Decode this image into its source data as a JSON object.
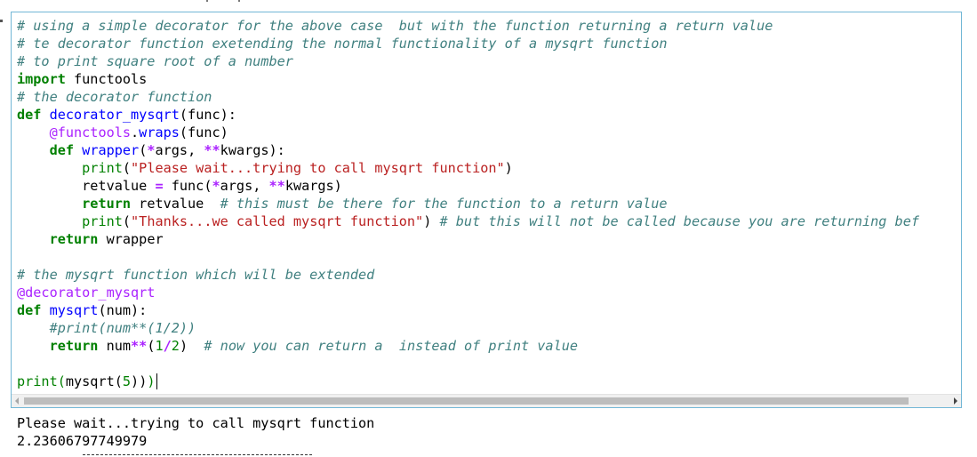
{
  "code_cell": {
    "lines": [
      [
        {
          "t": "c",
          "v": "# using a simple decorator for the above case  but with the function returning a return value"
        }
      ],
      [
        {
          "t": "c",
          "v": "# te decorator function exetending the normal functionality of a mysqrt function"
        }
      ],
      [
        {
          "t": "c",
          "v": "# to print square root of a number"
        }
      ],
      [
        {
          "t": "k",
          "v": "import"
        },
        {
          "t": "p",
          "v": " functools"
        }
      ],
      [
        {
          "t": "c",
          "v": "# the decorator function"
        }
      ],
      [
        {
          "t": "k",
          "v": "def"
        },
        {
          "t": "p",
          "v": " "
        },
        {
          "t": "fn",
          "v": "decorator_mysqrt"
        },
        {
          "t": "p",
          "v": "(func):"
        }
      ],
      [
        {
          "t": "p",
          "v": "    "
        },
        {
          "t": "d",
          "v": "@functools"
        },
        {
          "t": "p",
          "v": "."
        },
        {
          "t": "fn",
          "v": "wraps"
        },
        {
          "t": "p",
          "v": "(func)"
        }
      ],
      [
        {
          "t": "p",
          "v": "    "
        },
        {
          "t": "k",
          "v": "def"
        },
        {
          "t": "p",
          "v": " "
        },
        {
          "t": "fn",
          "v": "wrapper"
        },
        {
          "t": "p",
          "v": "("
        },
        {
          "t": "o",
          "v": "*"
        },
        {
          "t": "p",
          "v": "args, "
        },
        {
          "t": "o",
          "v": "**"
        },
        {
          "t": "p",
          "v": "kwargs):"
        }
      ],
      [
        {
          "t": "p",
          "v": "        "
        },
        {
          "t": "b",
          "v": "print"
        },
        {
          "t": "p",
          "v": "("
        },
        {
          "t": "s",
          "v": "\"Please wait...trying to call mysqrt function\""
        },
        {
          "t": "p",
          "v": ")"
        }
      ],
      [
        {
          "t": "p",
          "v": "        retvalue "
        },
        {
          "t": "o",
          "v": "="
        },
        {
          "t": "p",
          "v": " func("
        },
        {
          "t": "o",
          "v": "*"
        },
        {
          "t": "p",
          "v": "args, "
        },
        {
          "t": "o",
          "v": "**"
        },
        {
          "t": "p",
          "v": "kwargs)"
        }
      ],
      [
        {
          "t": "p",
          "v": "        "
        },
        {
          "t": "k",
          "v": "return"
        },
        {
          "t": "p",
          "v": " retvalue  "
        },
        {
          "t": "c",
          "v": "# this must be there for the function to a return value"
        }
      ],
      [
        {
          "t": "p",
          "v": "        "
        },
        {
          "t": "b",
          "v": "print"
        },
        {
          "t": "p",
          "v": "("
        },
        {
          "t": "s",
          "v": "\"Thanks...we called mysqrt function\""
        },
        {
          "t": "p",
          "v": ") "
        },
        {
          "t": "c",
          "v": "# but this will not be called because you are returning bef"
        }
      ],
      [
        {
          "t": "p",
          "v": "    "
        },
        {
          "t": "k",
          "v": "return"
        },
        {
          "t": "p",
          "v": " wrapper"
        }
      ],
      [],
      [
        {
          "t": "c",
          "v": "# the mysqrt function which will be extended"
        }
      ],
      [
        {
          "t": "d",
          "v": "@decorator_mysqrt"
        }
      ],
      [
        {
          "t": "k",
          "v": "def"
        },
        {
          "t": "p",
          "v": " "
        },
        {
          "t": "fn",
          "v": "mysqrt"
        },
        {
          "t": "p",
          "v": "(num):"
        }
      ],
      [
        {
          "t": "p",
          "v": "    "
        },
        {
          "t": "c",
          "v": "#print(num**(1/2))"
        }
      ],
      [
        {
          "t": "p",
          "v": "    "
        },
        {
          "t": "k",
          "v": "return"
        },
        {
          "t": "p",
          "v": " num"
        },
        {
          "t": "o",
          "v": "**"
        },
        {
          "t": "p",
          "v": "("
        },
        {
          "t": "n",
          "v": "1"
        },
        {
          "t": "o",
          "v": "/"
        },
        {
          "t": "n",
          "v": "2"
        },
        {
          "t": "p",
          "v": ")  "
        },
        {
          "t": "c",
          "v": "# now you can return a  instead of print value"
        }
      ],
      [],
      [
        {
          "t": "b",
          "v": "print"
        },
        {
          "t": "b",
          "v": "("
        },
        {
          "t": "p",
          "v": "mysqrt("
        },
        {
          "t": "n",
          "v": "5"
        },
        {
          "t": "p",
          "v": "))"
        },
        {
          "t": "b",
          "v": ")"
        }
      ]
    ]
  },
  "output": {
    "lines": [
      "Please wait...trying to call mysqrt function",
      "2.23606797749979"
    ]
  },
  "colors": {
    "comment": "#408080",
    "keyword": "#008000",
    "def_name": "#0000ff",
    "decorator": "#aa22ff",
    "string": "#ba2121",
    "cell_border": "#72b7d6"
  }
}
